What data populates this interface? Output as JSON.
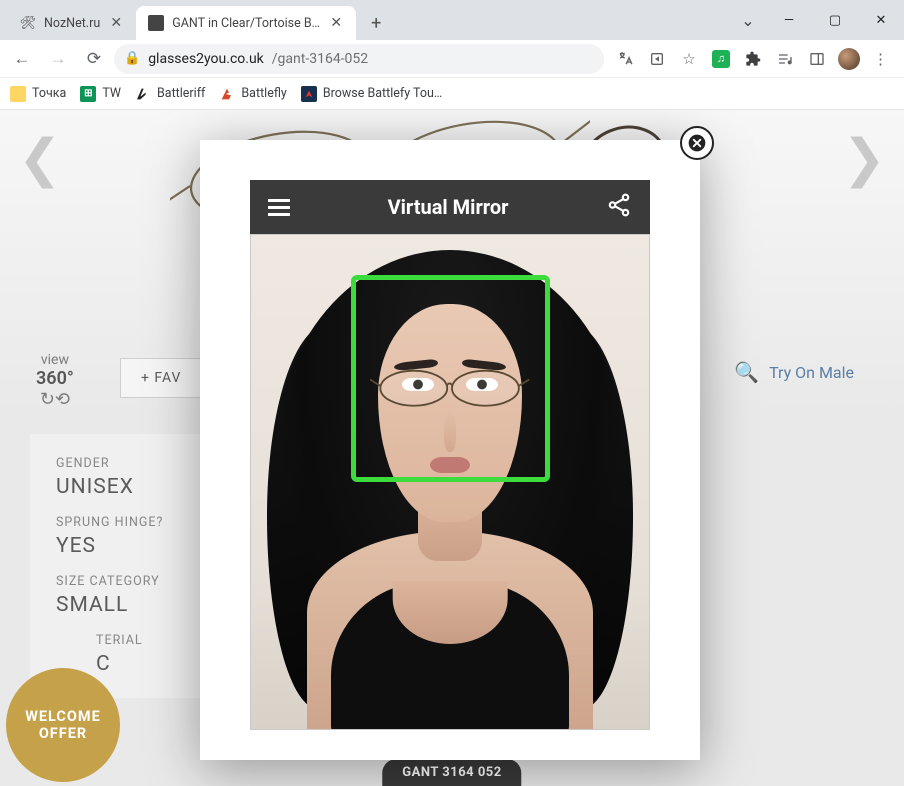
{
  "browser": {
    "tabs": [
      {
        "title": "NozNet.ru",
        "favicon": "🛠",
        "active": false
      },
      {
        "title": "GANT in Clear/Tortoise Brown A",
        "favicon": "◧",
        "active": true
      }
    ],
    "url_host": "glasses2you.co.uk",
    "url_path": "/gant-3164-052",
    "bookmarks": [
      {
        "label": "Точка",
        "icon": "yellow"
      },
      {
        "label": "TW",
        "icon": "green"
      },
      {
        "label": "Battleriff",
        "icon": "riff"
      },
      {
        "label": "Battlefly",
        "icon": "bfly"
      },
      {
        "label": "Browse Battlefy Tou…",
        "icon": "bfy"
      }
    ]
  },
  "page": {
    "view360_label": "view",
    "view360_value": "360°",
    "favourite_button": "+ FAV",
    "try_on_male": "Try On Male",
    "specs": [
      {
        "label": "GENDER",
        "value": "UNISEX"
      },
      {
        "label": "SPRUNG HINGE?",
        "value": "YES"
      },
      {
        "label": "SIZE CATEGORY",
        "value": "SMALL"
      },
      {
        "label": "TERIAL",
        "value": "C"
      }
    ],
    "welcome_offer_line1": "WELCOME",
    "welcome_offer_line2": "OFFER",
    "product_code": "GANT 3164 052"
  },
  "modal": {
    "title": "Virtual Mirror"
  }
}
